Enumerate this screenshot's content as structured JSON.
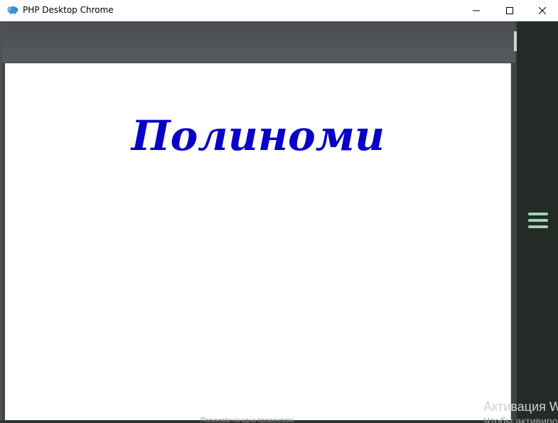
{
  "window": {
    "title": "PHP Desktop Chrome",
    "app_icon": "php-elephant-icon",
    "controls": {
      "minimize_icon": "minimize-icon",
      "maximize_icon": "maximize-icon",
      "close_icon": "close-icon"
    }
  },
  "page": {
    "heading": "Полиноми",
    "footer_text": "Полиноми на една променлива",
    "menu_icon": "hamburger-menu-icon"
  },
  "watermark": {
    "line1": "Активация Windows",
    "line2": "Чтобы активировать"
  },
  "colors": {
    "heading": "#0a00c8",
    "menu_icon": "#9fd3b3",
    "sidebar": "#242a26",
    "topband": "#525659"
  }
}
